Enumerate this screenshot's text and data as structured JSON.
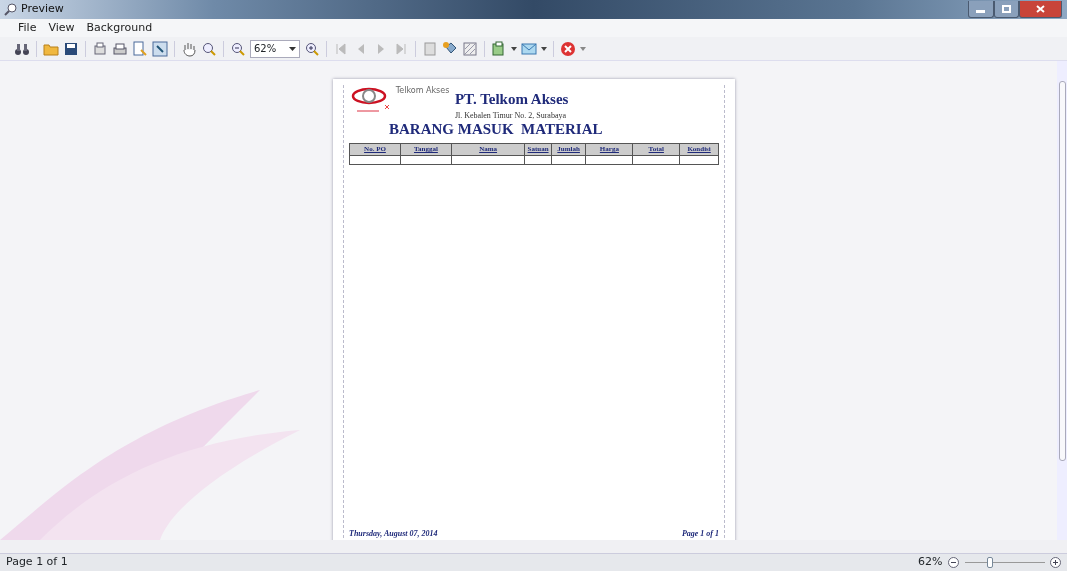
{
  "window": {
    "title": "Preview"
  },
  "menu": [
    "File",
    "View",
    "Background"
  ],
  "toolbar": {
    "zoom_field": {
      "value": "62%"
    }
  },
  "report": {
    "logo_text": "Telkom Akses",
    "company": "PT. Telkom Akses",
    "address": "Jl. Kebalen Timur No. 2, Surabaya",
    "title": "BARANG MASUK  MATERIAL",
    "columns": [
      "No. PO",
      "Tanggal",
      "Nama",
      "Satuan",
      "Jumlah",
      "Harga",
      "Total",
      "Kondisi"
    ],
    "footer_date": "Thursday, August 07, 2014",
    "footer_page": "Page 1 of 1"
  },
  "status_bar": {
    "page": "Page 1 of 1",
    "zoom": "62%",
    "zoom_slider": {
      "level": 0.3
    }
  }
}
